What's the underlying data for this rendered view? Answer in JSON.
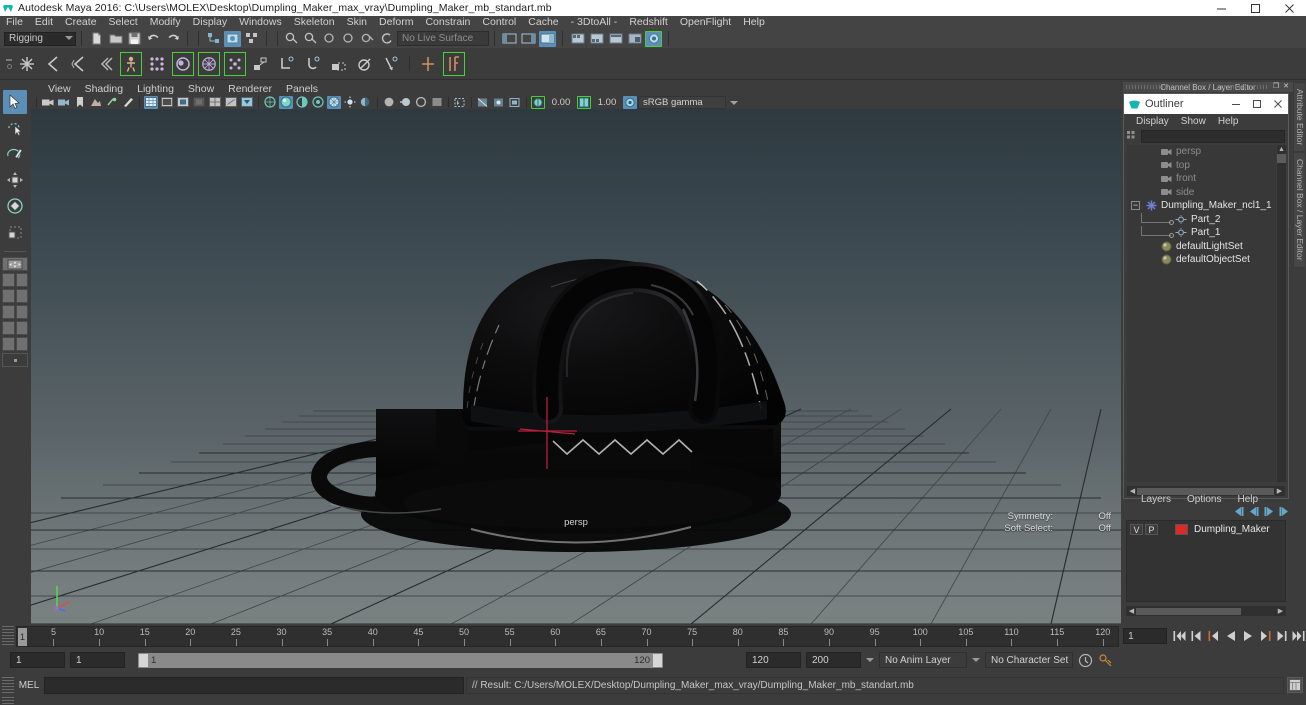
{
  "titlebar": {
    "app_title": "Autodesk Maya 2016: C:\\Users\\MOLEX\\Desktop\\Dumpling_Maker_max_vray\\Dumpling_Maker_mb_standart.mb",
    "minimize": "–",
    "maximize": "▢",
    "close": "✕"
  },
  "menubar": {
    "items": [
      {
        "label": "File"
      },
      {
        "label": "Edit"
      },
      {
        "label": "Create"
      },
      {
        "label": "Select"
      },
      {
        "label": "Modify"
      },
      {
        "label": "Display"
      },
      {
        "label": "Windows"
      },
      {
        "label": "Skeleton"
      },
      {
        "label": "Skin"
      },
      {
        "label": "Deform"
      },
      {
        "label": "Constrain"
      },
      {
        "label": "Control"
      },
      {
        "label": "Cache"
      },
      {
        "label": "- 3DtoAll -"
      },
      {
        "label": "Redshift"
      },
      {
        "label": "OpenFlight"
      },
      {
        "label": "Help"
      }
    ]
  },
  "status_toolbar": {
    "menuset": "Rigging",
    "live_surface": "No Live Surface"
  },
  "viewport_panel": {
    "menus": [
      {
        "label": "View"
      },
      {
        "label": "Shading"
      },
      {
        "label": "Lighting"
      },
      {
        "label": "Show"
      },
      {
        "label": "Renderer"
      },
      {
        "label": "Panels"
      }
    ],
    "exposure_value": "0.00",
    "gamma_value": "1.00",
    "color_profile": "sRGB gamma",
    "hud": {
      "symmetry_label": "Symmetry:",
      "symmetry_value": "Off",
      "soft_select_label": "Soft Select:",
      "soft_select_value": "Off",
      "camera_name": "persp"
    }
  },
  "right_dock": {
    "channelbox_header": "Channel Box / Layer Editor",
    "outliner": {
      "title": "Outliner",
      "menus": [
        {
          "label": "Display"
        },
        {
          "label": "Show"
        },
        {
          "label": "Help"
        }
      ],
      "search_value": "",
      "items": [
        {
          "label": "persp",
          "icon": "camera-icon",
          "dim": true,
          "indent": 1
        },
        {
          "label": "top",
          "icon": "camera-icon",
          "dim": true,
          "indent": 1
        },
        {
          "label": "front",
          "icon": "camera-icon",
          "dim": true,
          "indent": 1
        },
        {
          "label": "side",
          "icon": "camera-icon",
          "dim": true,
          "indent": 1
        },
        {
          "label": "Dumpling_Maker_ncl1_1",
          "icon": "asterisk-icon",
          "dim": false,
          "indent": 0,
          "expander": "−"
        },
        {
          "label": "Part_2",
          "icon": "mesh-icon",
          "dim": false,
          "indent": 2
        },
        {
          "label": "Part_1",
          "icon": "mesh-icon",
          "dim": false,
          "indent": 2
        },
        {
          "label": "defaultLightSet",
          "icon": "set-icon",
          "dim": false,
          "indent": 1
        },
        {
          "label": "defaultObjectSet",
          "icon": "set-icon",
          "dim": false,
          "indent": 1
        }
      ]
    },
    "layer_editor": {
      "menus": [
        {
          "label": "Layers"
        },
        {
          "label": "Options"
        },
        {
          "label": "Help"
        }
      ],
      "col_v": "V",
      "col_p": "P",
      "layers": [
        {
          "name": "Dumpling_Maker",
          "color": "#e02828",
          "v": "",
          "p": ""
        }
      ]
    },
    "vertical_tabs": [
      {
        "label": "Attribute Editor"
      },
      {
        "label": "Channel Box / Layer Editor"
      }
    ]
  },
  "timeline": {
    "current_frame": "1",
    "tick_labels": [
      "5",
      "10",
      "15",
      "20",
      "25",
      "30",
      "35",
      "40",
      "45",
      "50",
      "55",
      "60",
      "65",
      "70",
      "75",
      "80",
      "85",
      "90",
      "95",
      "100",
      "105",
      "110",
      "115",
      "120"
    ],
    "frame_field": "1",
    "range_start_field": "1",
    "range_start_field2": "1",
    "range_bar_start": "1",
    "range_bar_end": "120",
    "range_end_field": "120",
    "playback_end_field": "200",
    "anim_layer": "No Anim Layer",
    "character_set": "No Character Set"
  },
  "command_line": {
    "language": "MEL",
    "input_value": "",
    "output_text": "// Result: C:/Users/MOLEX/Desktop/Dumpling_Maker_max_vray/Dumpling_Maker_mb_standart.mb"
  },
  "colors": {
    "accent_blue": "#5c8fb8",
    "green_outline": "#49d039",
    "layer_red": "#e02828",
    "panel_bg": "#3c3c3c",
    "menu_bg": "#444444"
  }
}
